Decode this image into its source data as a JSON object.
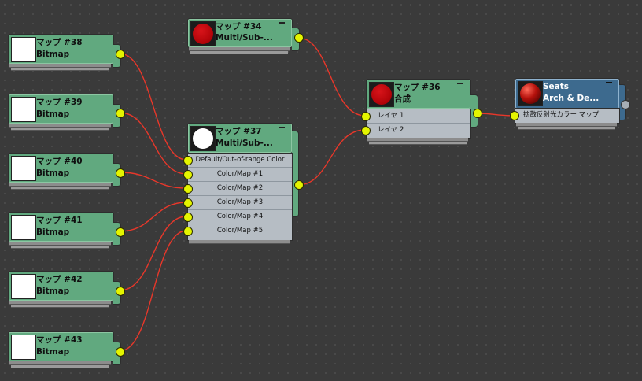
{
  "bitmap_nodes": [
    {
      "title": "マップ #38",
      "subtitle": "Bitmap"
    },
    {
      "title": "マップ #39",
      "subtitle": "Bitmap"
    },
    {
      "title": "マップ #40",
      "subtitle": "Bitmap"
    },
    {
      "title": "マップ #41",
      "subtitle": "Bitmap"
    },
    {
      "title": "マップ #42",
      "subtitle": "Bitmap"
    },
    {
      "title": "マップ #43",
      "subtitle": "Bitmap"
    }
  ],
  "node34": {
    "title": "マップ #34",
    "subtitle": "Multi/Sub-..."
  },
  "node37": {
    "title": "マップ #37",
    "subtitle": "Multi/Sub-...",
    "slots": [
      "Default/Out-of-range Color",
      "Color/Map #1",
      "Color/Map #2",
      "Color/Map #3",
      "Color/Map #4",
      "Color/Map #5"
    ]
  },
  "node36": {
    "title": "マップ #36",
    "subtitle": "合成",
    "slots": [
      "レイヤ 1",
      "レイヤ 2"
    ]
  },
  "material": {
    "title": "Seats",
    "subtitle": "Arch & De...",
    "slot": "拡散反射光カラー マップ"
  },
  "colors": {
    "node_green": "#61a97f",
    "material_blue": "#3d6a8e",
    "wire": "#e8372a",
    "socket": "#e4f500",
    "swatch_red": "#c8070d"
  }
}
